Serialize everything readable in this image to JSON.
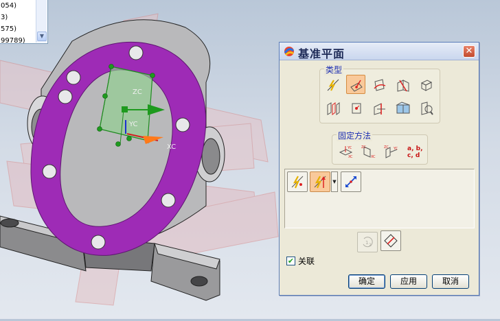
{
  "list_items": [
    "054)",
    "3)",
    "575)",
    "99789)"
  ],
  "scroll_down_glyph": "▼",
  "dialog": {
    "title": "基准平面",
    "close_glyph": "✕",
    "group_type_label": "类型",
    "group_fixed_label": "固定方法",
    "fixed_abcd_label_top": "a, b,",
    "fixed_abcd_label_bottom": "c, d",
    "associative_label": "关联",
    "check_glyph": "✔",
    "dropdown_glyph": "▼",
    "ok_label": "确定",
    "apply_label": "应用",
    "cancel_label": "取消"
  },
  "viewport": {
    "axis_labels": [
      "ZC",
      "YC",
      "XC"
    ],
    "part_color": "#9e2bb6",
    "plane_color": "#6ab86a"
  }
}
